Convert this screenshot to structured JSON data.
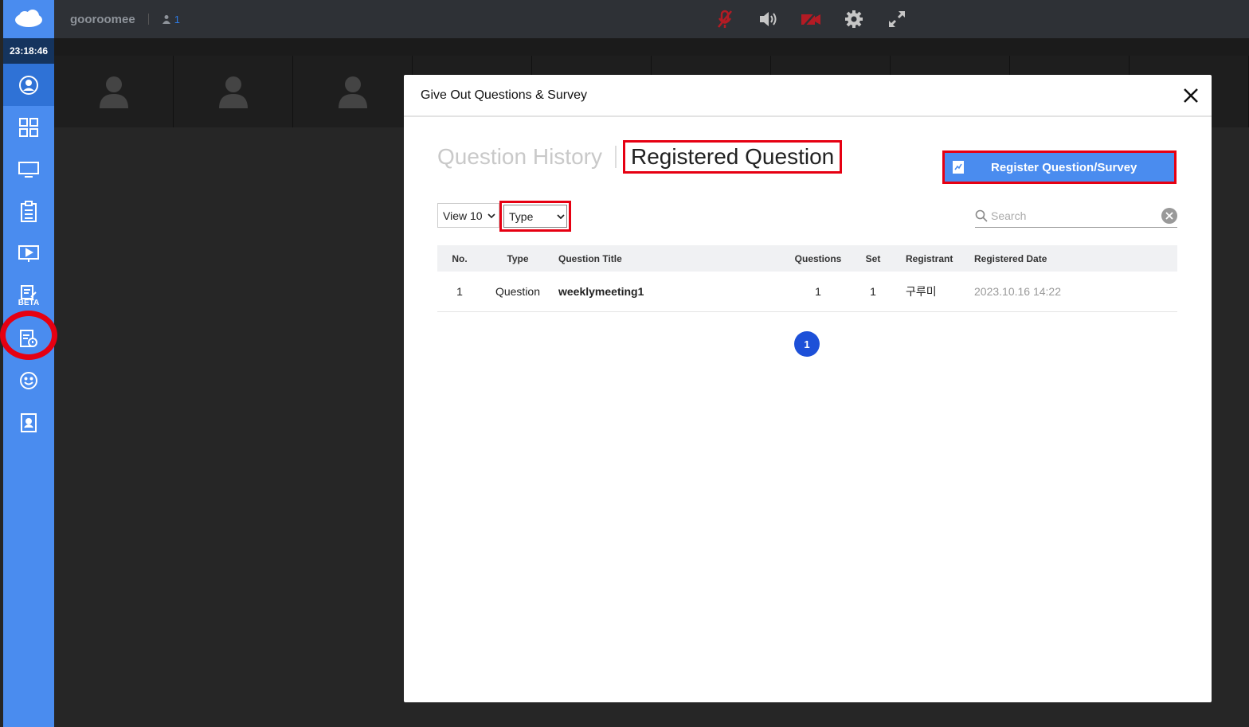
{
  "topbar": {
    "brand": "gooroomee",
    "user_count": "1",
    "controls": [
      "mic-muted-icon",
      "speaker-icon",
      "camera-off-icon",
      "settings-icon",
      "fullscreen-icon"
    ]
  },
  "sidebar": {
    "clock": "23:18:46",
    "items": [
      {
        "icon": "profile-icon"
      },
      {
        "icon": "grid-layout-icon"
      },
      {
        "icon": "screen-share-icon"
      },
      {
        "icon": "clipboard-icon"
      },
      {
        "icon": "presentation-icon"
      },
      {
        "icon": "note-edit-icon",
        "badge": "BETA"
      },
      {
        "icon": "question-survey-icon"
      },
      {
        "icon": "emoji-icon"
      },
      {
        "icon": "contact-card-icon"
      }
    ]
  },
  "modal": {
    "title": "Give Out Questions & Survey",
    "tab_history": "Question History",
    "tab_registered": "Registered Question",
    "register_button": "Register Question/Survey",
    "view_select": "View 10",
    "type_select": "Type",
    "search_placeholder": "Search",
    "columns": {
      "no": "No.",
      "type": "Type",
      "title": "Question Title",
      "questions": "Questions",
      "set": "Set",
      "registrant": "Registrant",
      "date": "Registered Date"
    },
    "rows": [
      {
        "no": "1",
        "type": "Question",
        "title": "weeklymeeting1",
        "questions": "1",
        "set": "1",
        "registrant": "구루미",
        "date": "2023.10.16 14:22"
      }
    ],
    "page": "1"
  },
  "colors": {
    "sidebar": "#4a8cef",
    "highlight": "#e60012",
    "pager": "#1d50d8"
  }
}
